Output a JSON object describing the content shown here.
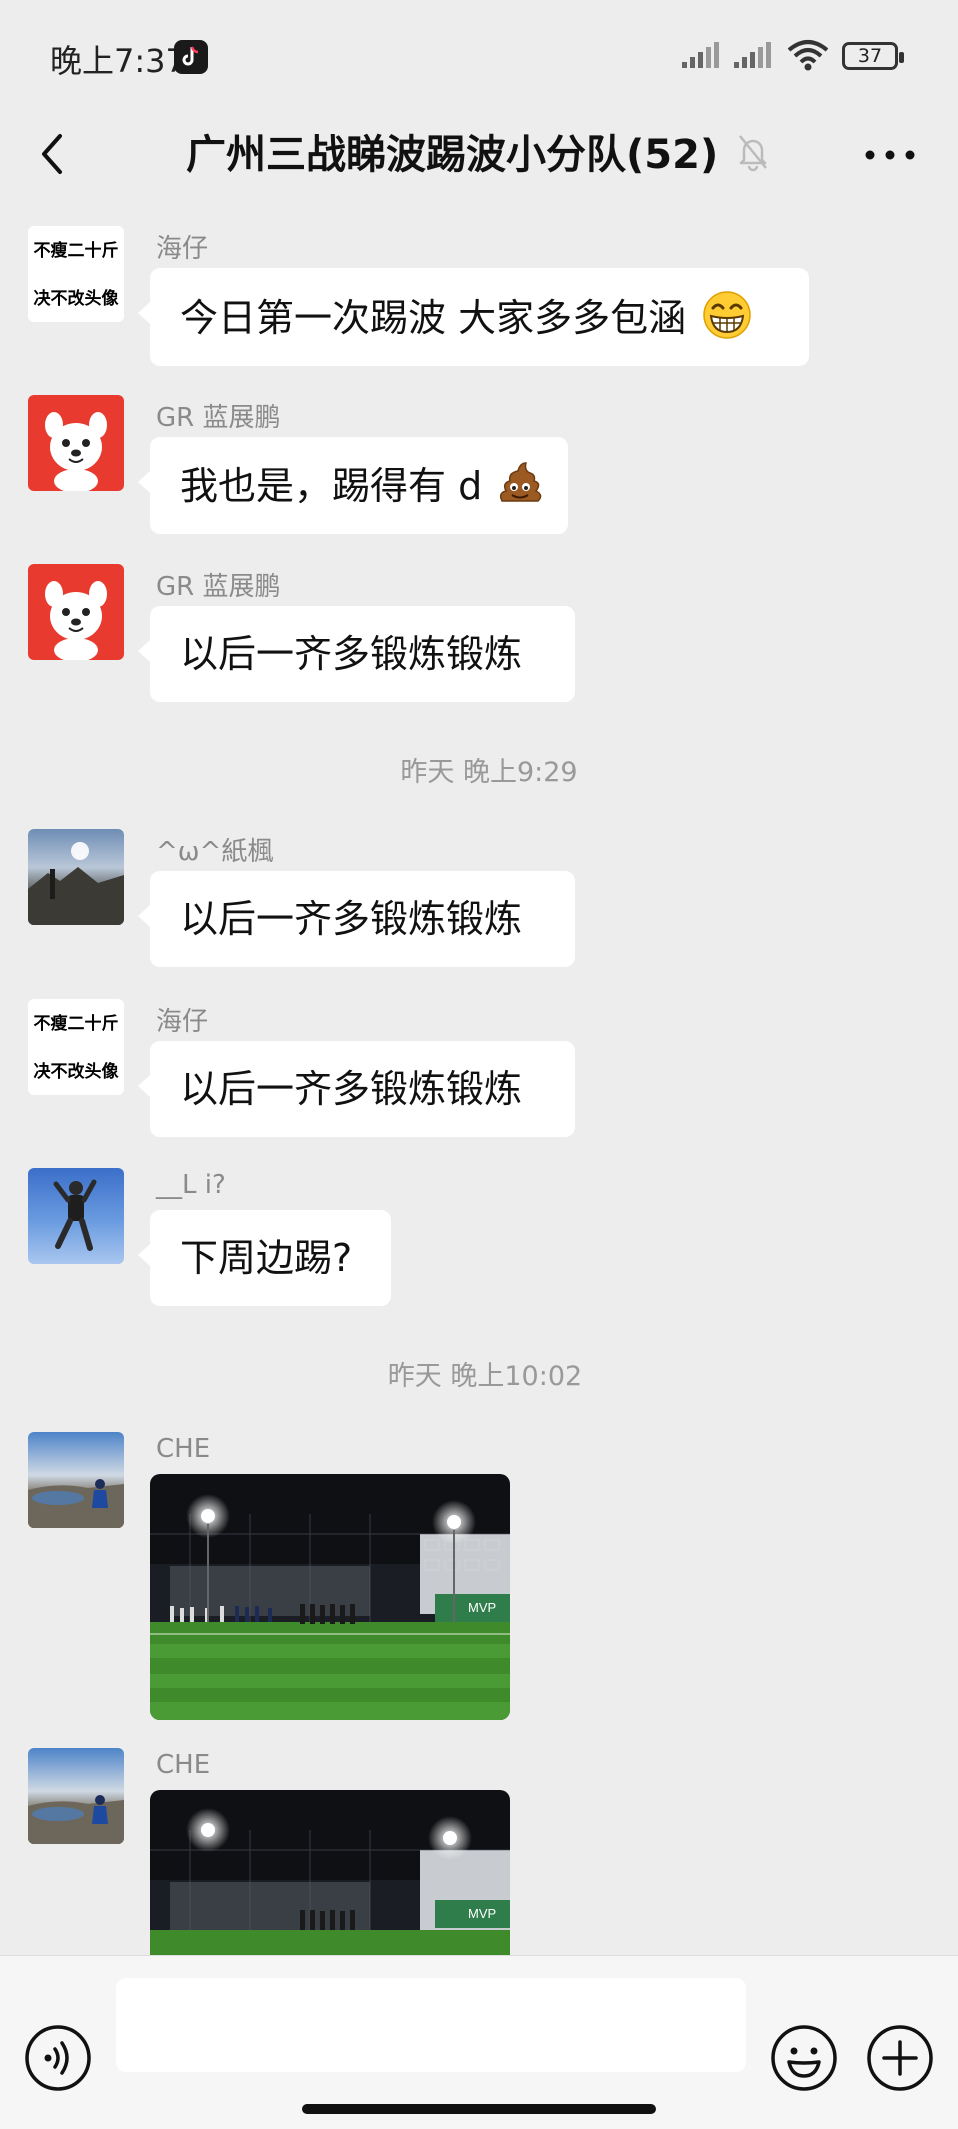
{
  "status_bar": {
    "time": "晚上7:37",
    "battery": "37"
  },
  "header": {
    "title": "广州三战睇波踢波小分队(52)"
  },
  "avatars": {
    "haizai_line1": "不瘦二十斤",
    "haizai_line2": "决不改头像"
  },
  "messages": [
    {
      "sender": "海仔",
      "text": "今日第一次踢波 大家多多包涵"
    },
    {
      "sender": "GR 蓝展鹏",
      "text": "我也是，踢得有 d"
    },
    {
      "sender": "GR 蓝展鹏",
      "text": "以后一齐多锻炼锻炼"
    },
    {
      "sender": "^ω^紙楓",
      "text": "以后一齐多锻炼锻炼"
    },
    {
      "sender": "海仔",
      "text": "以后一齐多锻炼锻炼"
    },
    {
      "sender": "__L i?",
      "text": "下周边踢?"
    },
    {
      "sender": "CHE",
      "photo": "football-pitch-night-photo"
    },
    {
      "sender": "CHE",
      "photo": "football-pitch-night-photo"
    }
  ],
  "timestamps": [
    "昨天 晚上9:29",
    "昨天 晚上10:02"
  ],
  "photo_text": "MVP",
  "colors": {
    "background": "#ededed",
    "bubble": "#ffffff",
    "meta_text": "#8a8a8a"
  }
}
